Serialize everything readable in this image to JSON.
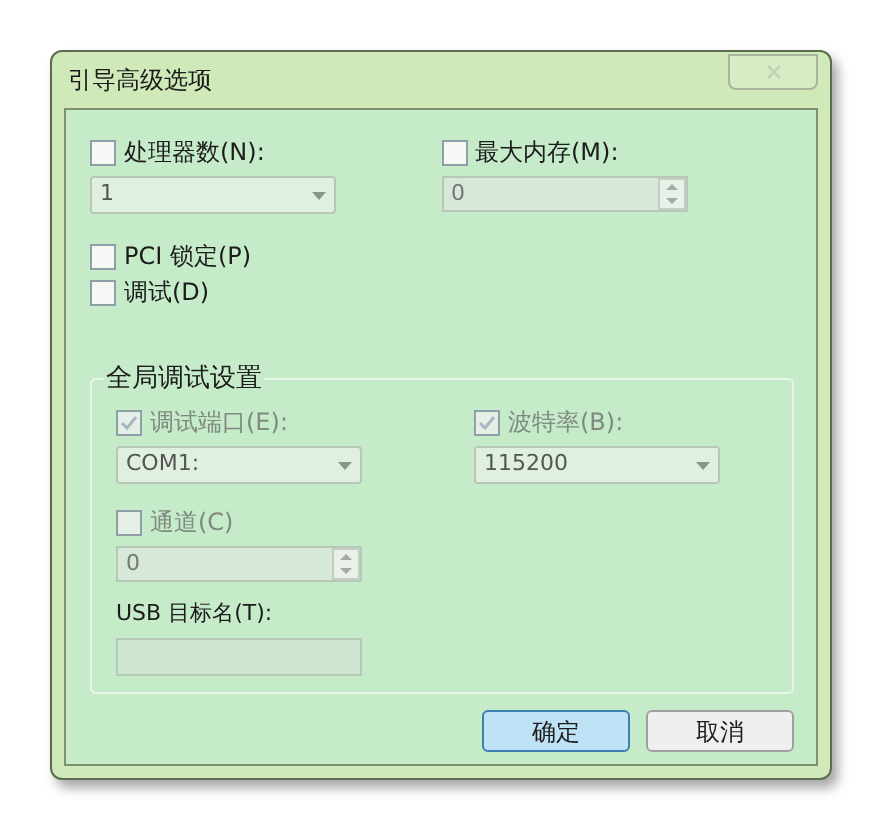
{
  "window": {
    "title": "引导高级选项"
  },
  "top_options": [
    {
      "label": "处理器数(N):",
      "checked": false,
      "control": {
        "kind": "combo",
        "value": "1"
      }
    },
    {
      "label": "最大内存(M):",
      "checked": false,
      "control": {
        "kind": "spin",
        "value": "0"
      }
    }
  ],
  "flags": [
    {
      "label": "PCI 锁定(P)",
      "checked": false
    },
    {
      "label": "调试(D)",
      "checked": false
    }
  ],
  "debug_group": {
    "title": "全局调试设置",
    "options": [
      {
        "label": "调试端口(E):",
        "checked": true,
        "disabled": true,
        "control": {
          "kind": "combo",
          "value": "COM1:"
        }
      },
      {
        "label": "波特率(B):",
        "checked": true,
        "disabled": true,
        "control": {
          "kind": "combo",
          "value": "115200"
        }
      },
      {
        "label": "通道(C)",
        "checked": false,
        "disabled": true,
        "control": {
          "kind": "spin",
          "value": "0"
        }
      }
    ],
    "usb": {
      "label": "USB 目标名(T):"
    }
  },
  "buttons": [
    {
      "label": "确定",
      "default": true
    },
    {
      "label": "取消",
      "default": false
    }
  ]
}
